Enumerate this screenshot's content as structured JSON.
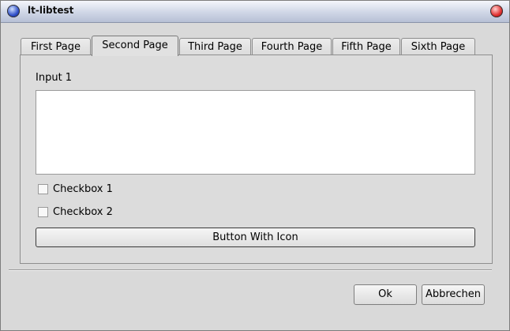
{
  "window": {
    "title": "lt-libtest"
  },
  "tabs": [
    {
      "label": "First Page"
    },
    {
      "label": "Second Page"
    },
    {
      "label": "Third Page"
    },
    {
      "label": "Fourth Page"
    },
    {
      "label": "Fifth Page"
    },
    {
      "label": "Sixth Page"
    }
  ],
  "active_tab": "Second Page",
  "form": {
    "input_label": "Input 1",
    "input_value": "",
    "checkbox1": {
      "label": "Checkbox 1",
      "checked": false
    },
    "checkbox2": {
      "label": "Checkbox 2",
      "checked": false
    },
    "wide_button_label": "Button With Icon"
  },
  "dialog_buttons": {
    "ok": "Ok",
    "cancel": "Abbrechen"
  }
}
